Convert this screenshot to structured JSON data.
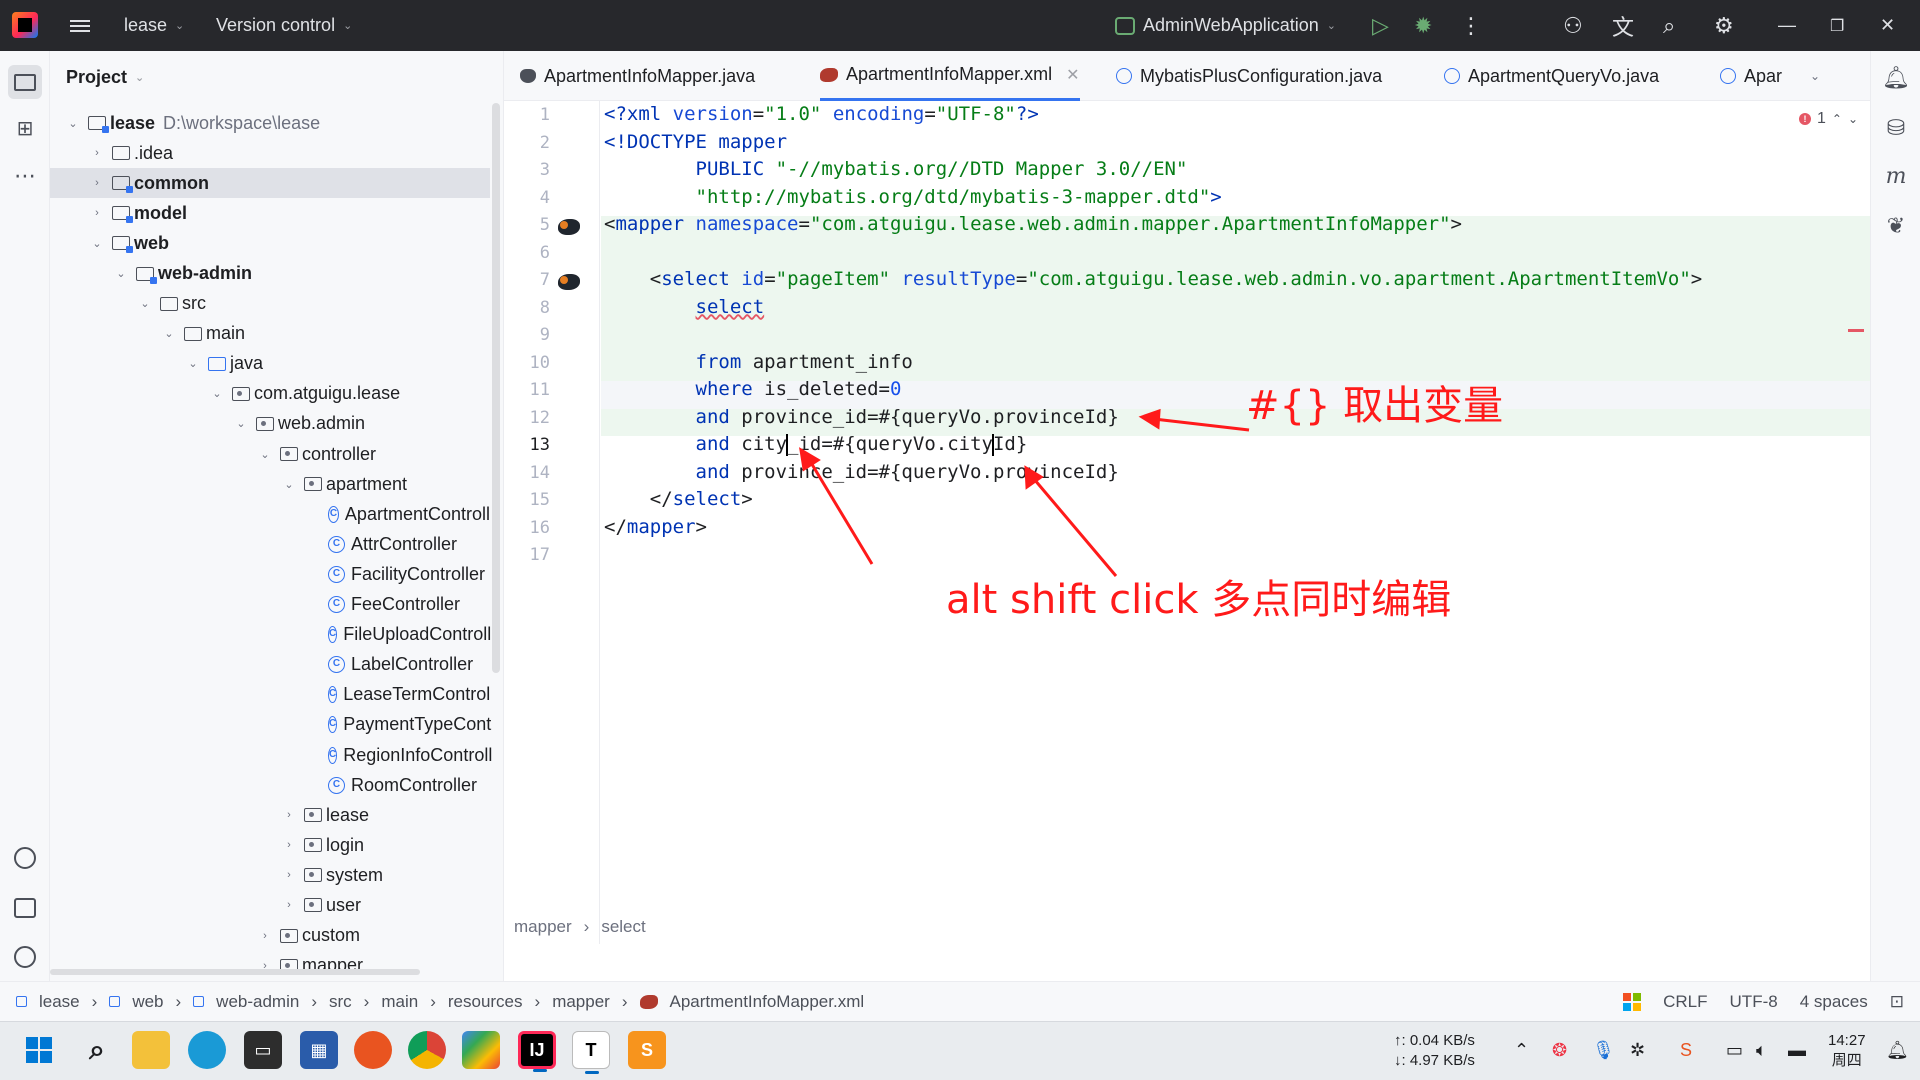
{
  "titlebar": {
    "project": "lease",
    "vcs": "Version control",
    "run_config": "AdminWebApplication"
  },
  "sidebar": {
    "header": "Project",
    "tree": [
      {
        "label": "lease",
        "path": "D:\\workspace\\lease"
      },
      {
        "label": ".idea"
      },
      {
        "label": "common"
      },
      {
        "label": "model"
      },
      {
        "label": "web"
      },
      {
        "label": "web-admin"
      },
      {
        "label": "src"
      },
      {
        "label": "main"
      },
      {
        "label": "java"
      },
      {
        "label": "com.atguigu.lease"
      },
      {
        "label": "web.admin"
      },
      {
        "label": "controller"
      },
      {
        "label": "apartment"
      },
      {
        "label": "ApartmentControll"
      },
      {
        "label": "AttrController"
      },
      {
        "label": "FacilityController"
      },
      {
        "label": "FeeController"
      },
      {
        "label": "FileUploadControll"
      },
      {
        "label": "LabelController"
      },
      {
        "label": "LeaseTermControl"
      },
      {
        "label": "PaymentTypeCont"
      },
      {
        "label": "RegionInfoControll"
      },
      {
        "label": "RoomController"
      },
      {
        "label": "lease"
      },
      {
        "label": "login"
      },
      {
        "label": "system"
      },
      {
        "label": "user"
      },
      {
        "label": "custom"
      },
      {
        "label": "mapper"
      }
    ]
  },
  "tabs": [
    {
      "label": "ApartmentInfoMapper.java"
    },
    {
      "label": "ApartmentInfoMapper.xml"
    },
    {
      "label": "MybatisPlusConfiguration.java"
    },
    {
      "label": "ApartmentQueryVo.java"
    },
    {
      "label": "Apar"
    }
  ],
  "editor": {
    "error_count": "1",
    "line_numbers": [
      "1",
      "2",
      "3",
      "4",
      "5",
      "6",
      "7",
      "8",
      "9",
      "10",
      "11",
      "12",
      "13",
      "14",
      "15",
      "16",
      "17"
    ],
    "lines": {
      "l1": {
        "p1": "<?xml ",
        "p2": "version",
        "p3": "=",
        "p4": "\"1.0\"",
        "p5": " ",
        "p6": "encoding",
        "p7": "=",
        "p8": "\"UTF-8\"",
        "p9": "?>"
      },
      "l2": {
        "p1": "<!DOCTYPE ",
        "p2": "mapper"
      },
      "l3": {
        "p1": "        PUBLIC ",
        "p2": "\"-//mybatis.org//DTD Mapper 3.0//EN\""
      },
      "l4": {
        "p1": "        ",
        "p2": "\"http://mybatis.org/dtd/mybatis-3-mapper.dtd\"",
        "p3": ">"
      },
      "l5": {
        "p1": "<",
        "p2": "mapper",
        "p3": " ",
        "p4": "namespace",
        "p5": "=",
        "p6": "\"com.atguigu.lease.web.admin.mapper.ApartmentInfoMapper\"",
        "p7": ">"
      },
      "l7": {
        "p1": "    <",
        "p2": "select",
        "p3": " ",
        "p4": "id",
        "p5": "=",
        "p6": "\"pageItem\"",
        "p7": " ",
        "p8": "resultType",
        "p9": "=",
        "p10": "\"com.atguigu.lease.web.admin.vo.apartment.ApartmentItemVo\"",
        "p11": ">"
      },
      "l8": {
        "p1": "        ",
        "p2": "select"
      },
      "l10": {
        "p1": "        ",
        "p2": "from",
        "p3": " apartment_info"
      },
      "l11": {
        "p1": "        ",
        "p2": "where",
        "p3": " is_deleted=",
        "p4": "0"
      },
      "l12": {
        "p1": "        ",
        "p2": "and",
        "p3": " province_id=#{queryVo.provinceId}"
      },
      "l13": {
        "p1": "        ",
        "p2": "and",
        "p3": " city",
        "p4": "_id=#{queryVo.city",
        "p5": "Id}"
      },
      "l14": {
        "p1": "        ",
        "p2": "and",
        "p3": " province_id=#{queryVo.provinceId}"
      },
      "l15": {
        "p1": "    </",
        "p2": "select",
        "p3": ">"
      },
      "l16": {
        "p1": "</",
        "p2": "mapper",
        "p3": ">"
      }
    },
    "breadcrumbs": [
      "mapper",
      "select"
    ],
    "annotations": {
      "variable": "#{} 取出变量",
      "multi_edit": "alt shift click 多点同时编辑"
    }
  },
  "statusbar": {
    "path": [
      "lease",
      "web",
      "web-admin",
      "src",
      "main",
      "resources",
      "mapper",
      "ApartmentInfoMapper.xml"
    ],
    "line_sep": "CRLF",
    "encoding": "UTF-8",
    "indent": "4 spaces"
  },
  "taskbar": {
    "net_up": "↑: 0.04 KB/s",
    "net_down": "↓: 4.97 KB/s",
    "time": "14:27",
    "weekday": "周四"
  },
  "colors": {
    "accent": "#3574f0",
    "annotation": "#ff1a1a",
    "added_line_bg": "#edf7ef"
  }
}
